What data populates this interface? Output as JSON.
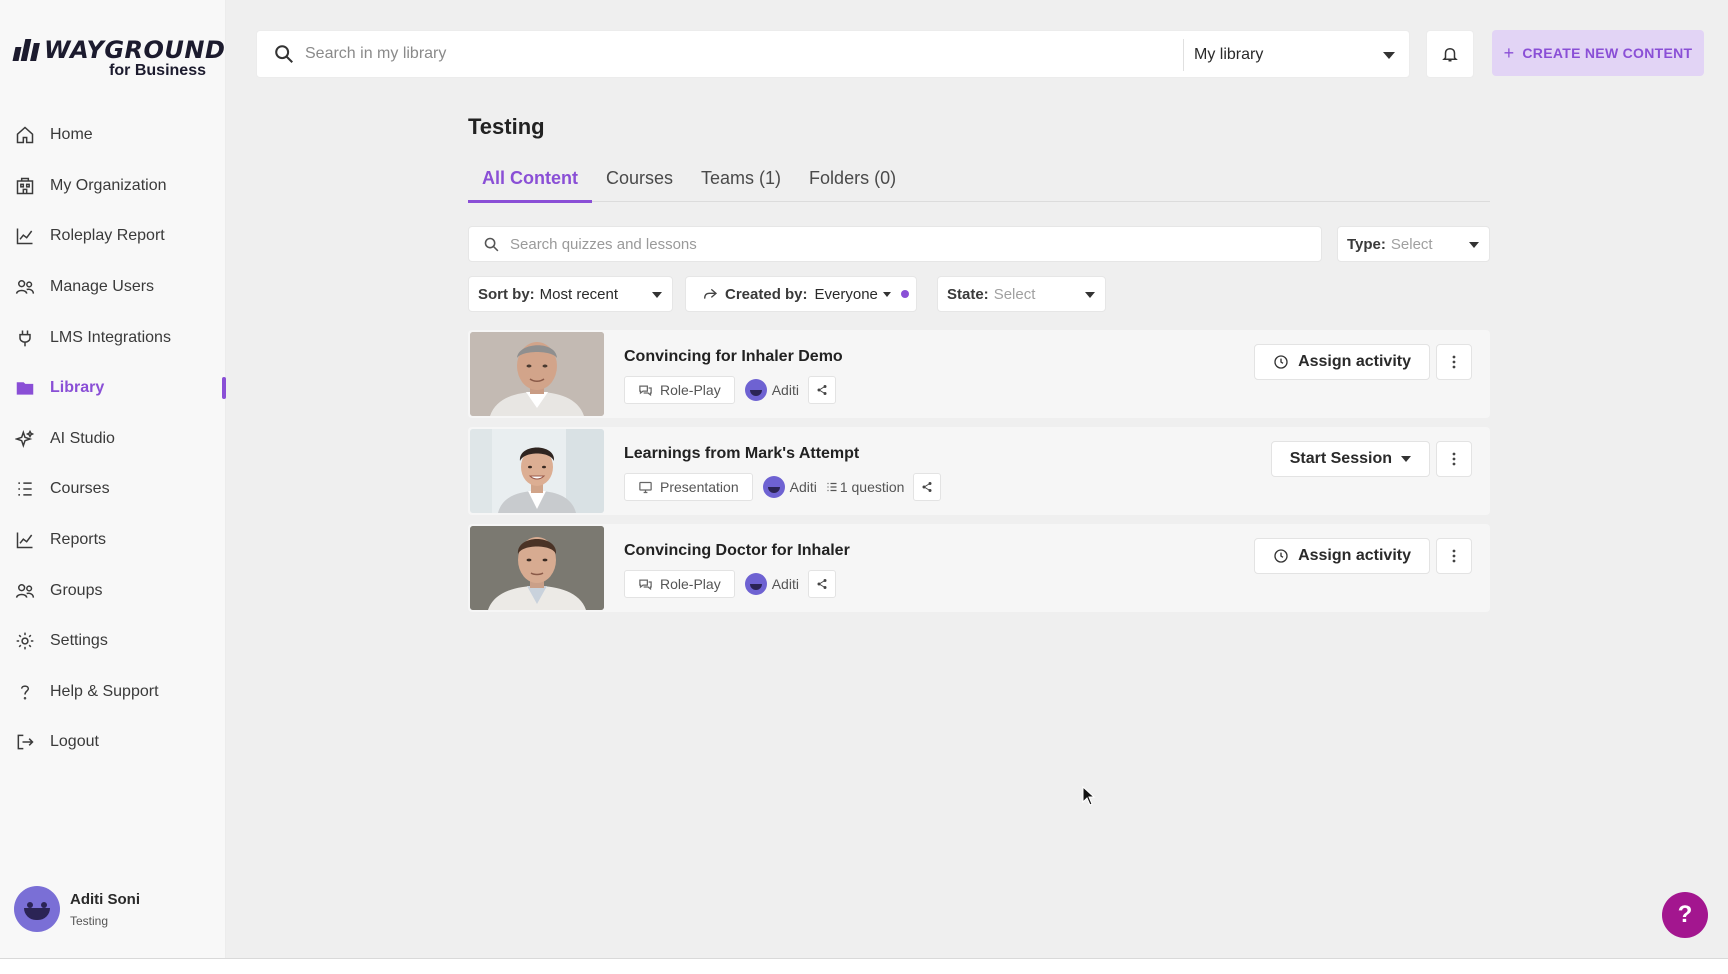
{
  "brand": {
    "name": "WAYGROUND",
    "sub": "for Business"
  },
  "sidebar": {
    "items": [
      {
        "label": "Home",
        "icon": "home-icon"
      },
      {
        "label": "My Organization",
        "icon": "building-icon"
      },
      {
        "label": "Roleplay Report",
        "icon": "line-chart-icon"
      },
      {
        "label": "Manage Users",
        "icon": "users-icon"
      },
      {
        "label": "LMS Integrations",
        "icon": "plug-icon"
      },
      {
        "label": "Library",
        "icon": "folder-icon",
        "active": true
      },
      {
        "label": "AI Studio",
        "icon": "sparkle-icon"
      },
      {
        "label": "Courses",
        "icon": "list-icon"
      },
      {
        "label": "Reports",
        "icon": "line-chart-icon"
      },
      {
        "label": "Groups",
        "icon": "users-icon"
      },
      {
        "label": "Settings",
        "icon": "gear-icon"
      },
      {
        "label": "Help & Support",
        "icon": "question-icon"
      },
      {
        "label": "Logout",
        "icon": "logout-icon"
      }
    ],
    "user": {
      "name": "Aditi Soni",
      "org": "Testing"
    }
  },
  "header": {
    "search_placeholder": "Search in my library",
    "library_select": "My library",
    "create_label": "CREATE NEW CONTENT"
  },
  "main": {
    "title": "Testing",
    "tabs": [
      {
        "label": "All Content",
        "active": true
      },
      {
        "label": "Courses"
      },
      {
        "label": "Teams (1)"
      },
      {
        "label": "Folders (0)"
      }
    ],
    "search_placeholder": "Search quizzes and lessons",
    "filters": {
      "type_label": "Type:",
      "type_value": "Select",
      "sort_label": "Sort by:",
      "sort_value": "Most recent",
      "created_label": "Created by:",
      "created_value": "Everyone",
      "state_label": "State:",
      "state_value": "Select"
    },
    "items": [
      {
        "title": "Convincing for Inhaler Demo",
        "type": "Role-Play",
        "author": "Aditi",
        "questions": "",
        "action": "Assign activity"
      },
      {
        "title": "Learnings from Mark's Attempt",
        "type": "Presentation",
        "author": "Aditi",
        "questions": "1 question",
        "action": "Start Session"
      },
      {
        "title": "Convincing Doctor for Inhaler",
        "type": "Role-Play",
        "author": "Aditi",
        "questions": "",
        "action": "Assign activity"
      }
    ]
  },
  "help_fab": "?",
  "colors": {
    "accent": "#8a4fd6",
    "create_bg": "#e2d4f5",
    "help_fab": "#a3168f",
    "page_bg": "#efefef"
  }
}
